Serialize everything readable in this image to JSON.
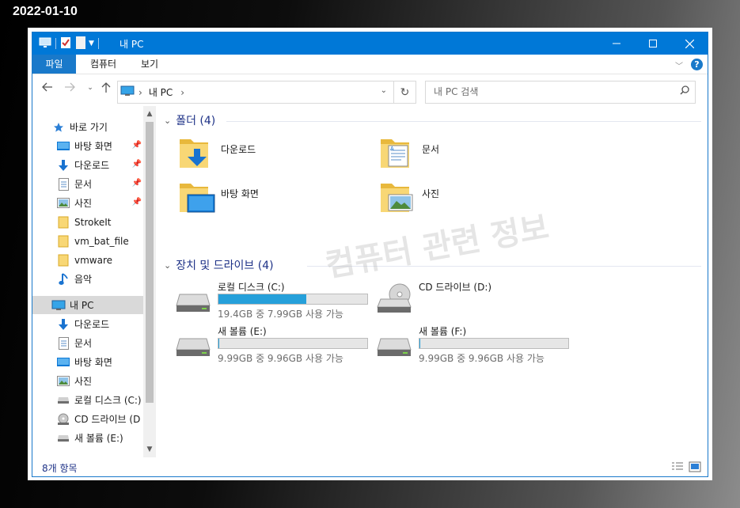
{
  "date_stamp": "2022-01-10",
  "window": {
    "title": "내 PC",
    "controls": {
      "minimize": "minimize-icon",
      "maximize": "maximize-icon",
      "close": "close-icon"
    },
    "accent": "#0078d7"
  },
  "ribbon": {
    "tabs": [
      {
        "label": "파일",
        "active": true
      },
      {
        "label": "컴퓨터",
        "active": false
      },
      {
        "label": "보기",
        "active": false
      }
    ]
  },
  "address": {
    "segments": [
      "내 PC"
    ],
    "search_placeholder": "내 PC 검색"
  },
  "nav": {
    "quick_access_label": "바로 가기",
    "items": [
      {
        "label": "바탕 화면",
        "icon": "desktop-icon",
        "pinned": true
      },
      {
        "label": "다운로드",
        "icon": "download-icon",
        "pinned": true
      },
      {
        "label": "문서",
        "icon": "document-icon",
        "pinned": true
      },
      {
        "label": "사진",
        "icon": "picture-icon",
        "pinned": true
      },
      {
        "label": "StrokeIt",
        "icon": "folder-icon",
        "pinned": false
      },
      {
        "label": "vm_bat_file",
        "icon": "folder-icon",
        "pinned": false
      },
      {
        "label": "vmware",
        "icon": "folder-icon",
        "pinned": false
      },
      {
        "label": "음악",
        "icon": "music-icon",
        "pinned": false
      }
    ],
    "this_pc_label": "내 PC",
    "this_pc_items": [
      {
        "label": "다운로드",
        "icon": "download-icon"
      },
      {
        "label": "문서",
        "icon": "document-icon"
      },
      {
        "label": "바탕 화면",
        "icon": "desktop-icon"
      },
      {
        "label": "사진",
        "icon": "picture-icon"
      },
      {
        "label": "로컬 디스크 (C:)",
        "icon": "drive-icon"
      },
      {
        "label": "CD 드라이브 (D",
        "icon": "cd-icon"
      },
      {
        "label": "새 볼륨 (E:)",
        "icon": "drive-icon"
      }
    ]
  },
  "content": {
    "folders_header": "폴더 (4)",
    "folders": [
      {
        "name": "다운로드",
        "overlay": "download"
      },
      {
        "name": "문서",
        "overlay": "document"
      },
      {
        "name": "바탕 화면",
        "overlay": "desktop"
      },
      {
        "name": "사진",
        "overlay": "picture"
      }
    ],
    "drives_header": "장치 및 드라이브 (4)",
    "drives": [
      {
        "name": "로컬 디스크 (C:)",
        "size": "19.4GB 중 7.99GB 사용 가능",
        "used_fraction": 0.59,
        "type": "hdd"
      },
      {
        "name": "CD 드라이브 (D:)",
        "size": "",
        "used_fraction": null,
        "type": "cd"
      },
      {
        "name": "새 볼륨 (E:)",
        "size": "9.99GB 중 9.96GB 사용 가능",
        "used_fraction": 0.003,
        "type": "hdd"
      },
      {
        "name": "새 볼륨 (F:)",
        "size": "9.99GB 중 9.96GB 사용 가능",
        "used_fraction": 0.003,
        "type": "hdd"
      }
    ],
    "watermark": "컴퓨터 관련 정보"
  },
  "status": {
    "item_count": "8개 항목"
  }
}
